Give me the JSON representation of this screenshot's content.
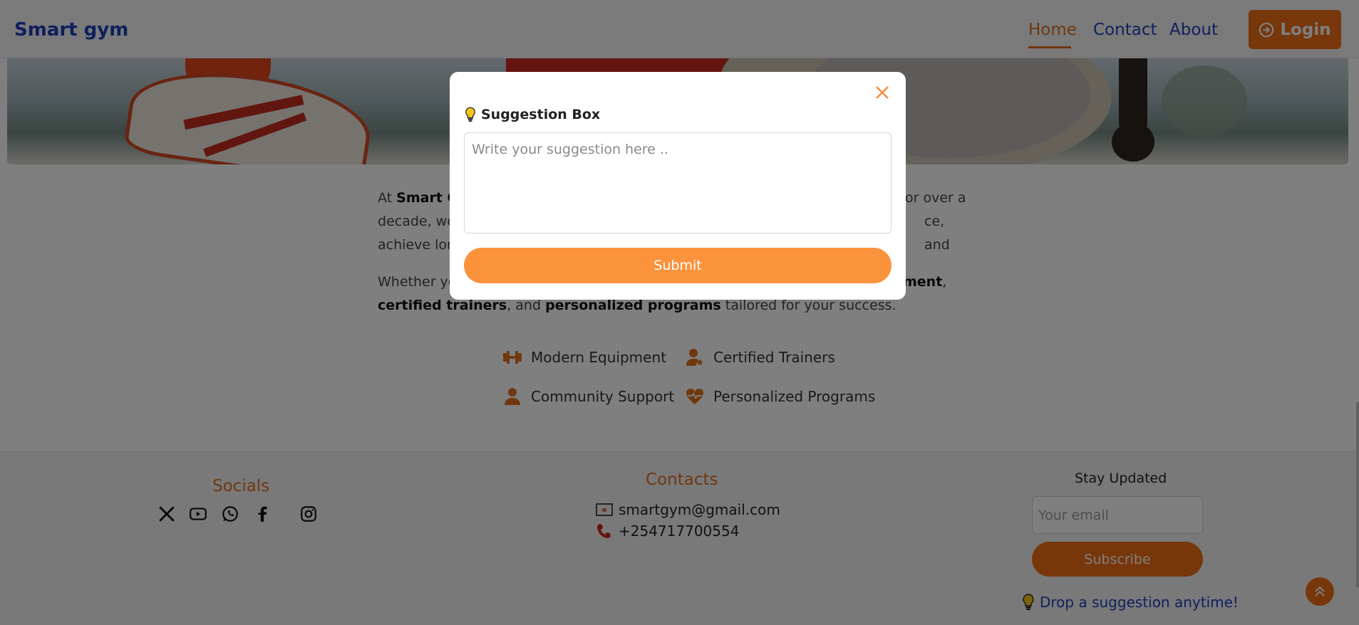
{
  "header": {
    "brand": "Smart gym",
    "nav": [
      {
        "label": "Home",
        "active": true
      },
      {
        "label": "Contact",
        "active": false
      },
      {
        "label": "About",
        "active": false
      }
    ],
    "login_label": "Login",
    "login_icon": "sign-in-icon"
  },
  "about": {
    "para1": {
      "prefix": "At ",
      "brand": "Smart G",
      "mid1": "",
      "right1": "or over a",
      "line2_left": "decade, we",
      "line2_right": "ce, and",
      "line3_left": "achieve lon"
    },
    "para2": {
      "line1_left": "Whether yo",
      "line1_right_bold": "ment",
      "line1_right_tail": ",",
      "bold1": "certified trainers",
      "mid": ", and ",
      "bold2": "personalized programs",
      "tail": " tailored for your success."
    },
    "features": [
      {
        "label": "Modern Equipment",
        "icon": "dumbbell-icon"
      },
      {
        "label": "Certified Trainers",
        "icon": "trainer-icon"
      },
      {
        "label": "Community Support",
        "icon": "community-icon"
      },
      {
        "label": "Personalized Programs",
        "icon": "heart-pulse-icon"
      }
    ]
  },
  "footer": {
    "socials_title": "Socials",
    "socials": [
      "x-icon",
      "youtube-icon",
      "whatsapp-icon",
      "facebook-icon",
      "instagram-icon"
    ],
    "contacts_title": "Contacts",
    "email": "smartgym@gmail.com",
    "phone": "+254717700554",
    "stay_title": "Stay Updated",
    "email_placeholder": "Your email",
    "subscribe_label": "Subscribe",
    "suggest_link": "Drop a suggestion anytime!"
  },
  "modal": {
    "title": "Suggestion Box",
    "placeholder": "Write your suggestion here ..",
    "submit_label": "Submit"
  },
  "colors": {
    "accent": "#ee6e14",
    "submit": "#fb923c",
    "brand": "#1f3fb8"
  }
}
